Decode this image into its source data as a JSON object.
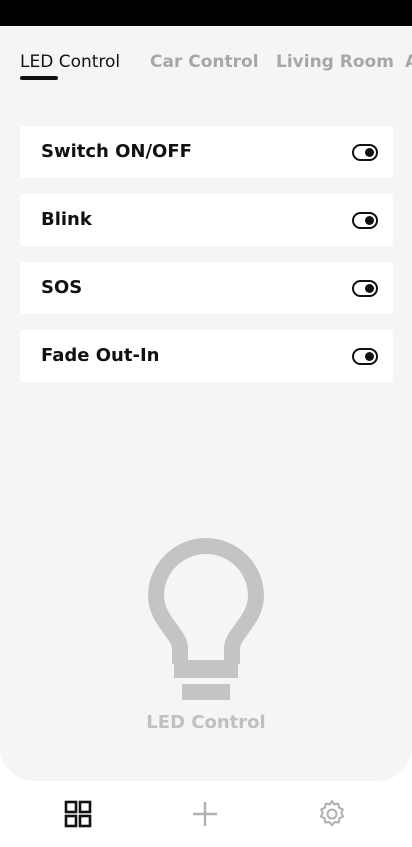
{
  "tabs": [
    {
      "label": "LED Control",
      "active": true
    },
    {
      "label": "Car Control",
      "active": false
    },
    {
      "label": "Living Room",
      "active": false
    },
    {
      "label": "A",
      "active": false
    }
  ],
  "controls": [
    {
      "label": "Switch ON/OFF",
      "toggle_icon": "toggle-icon"
    },
    {
      "label": "Blink",
      "toggle_icon": "toggle-icon"
    },
    {
      "label": "SOS",
      "toggle_icon": "toggle-icon"
    },
    {
      "label": "Fade Out-In",
      "toggle_icon": "toggle-icon"
    }
  ],
  "hero": {
    "icon": "lightbulb-icon",
    "caption": "LED Control"
  },
  "bottom_nav": {
    "items": [
      {
        "icon": "grid-icon",
        "active": true
      },
      {
        "icon": "plus-icon",
        "active": false
      },
      {
        "icon": "gear-icon",
        "active": false
      }
    ]
  },
  "colors": {
    "background": "#f4f5f7",
    "card": "#ffffff",
    "text": "#111111",
    "muted": "#a7a7a7",
    "bulb": "#c4c4c4"
  }
}
